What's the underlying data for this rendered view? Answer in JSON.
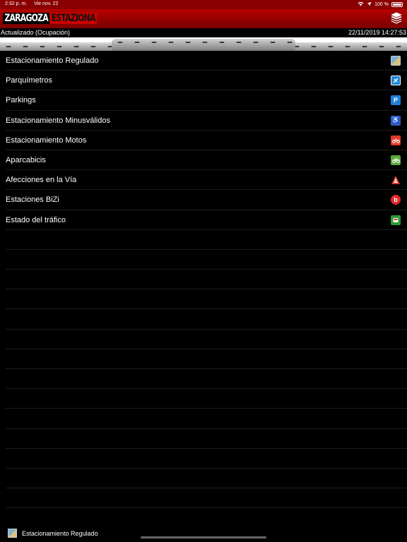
{
  "status": {
    "time": "2:32 p. m.",
    "date": "Vie nov. 22",
    "battery": "100 %"
  },
  "header": {
    "logo_part1": "ZARAGOZA",
    "logo_part2": "ESTAZIONA"
  },
  "info": {
    "updated": "Actualizado (Ocupación)",
    "datetime": "22/11/2019 14:27:53"
  },
  "layers": [
    {
      "label": "Estacionamiento Regulado",
      "icon": "regulated-parking-icon",
      "color": "#7fb1d8"
    },
    {
      "label": "Parquímetros",
      "icon": "parking-meter-icon",
      "color": "#1e88d8"
    },
    {
      "label": "Parkings",
      "icon": "parking-p-icon",
      "color": "#1e7fd8",
      "glyph": "P"
    },
    {
      "label": "Estacionamiento Minusválidos",
      "icon": "wheelchair-icon",
      "color": "#3b5bb8",
      "glyph": "♿"
    },
    {
      "label": "Estacionamiento Motos",
      "icon": "motorcycle-icon",
      "color": "#e03a2a"
    },
    {
      "label": "Aparcabicis",
      "icon": "bicycle-icon",
      "color": "#5aa83a"
    },
    {
      "label": "Afecciones en la Vía",
      "icon": "road-works-icon",
      "color": "#e03a2a"
    },
    {
      "label": "Estaciones BiZi",
      "icon": "bizi-icon",
      "color": "#e02a2a",
      "glyph": "b"
    },
    {
      "label": "Estado del tráfico",
      "icon": "traffic-icon",
      "color": "#2e9a3a"
    }
  ],
  "footer": {
    "selected": "Estacionamiento Regulado"
  }
}
